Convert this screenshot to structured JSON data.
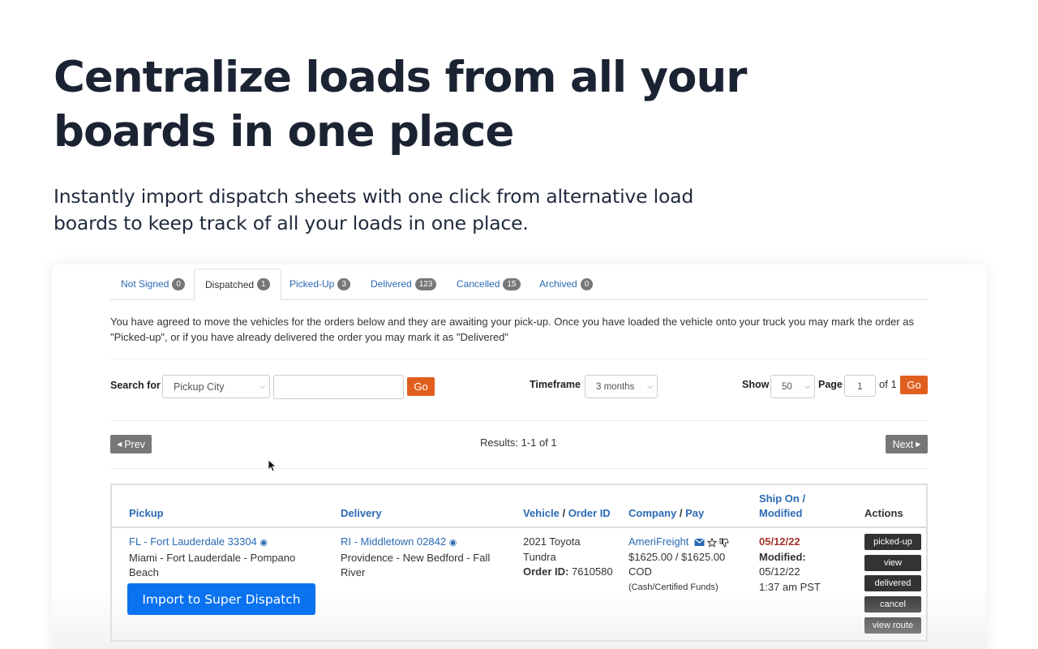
{
  "hero": {
    "title": "Centralize loads from all your boards in one place",
    "subtitle": "Instantly import dispatch sheets with one click from alternative load boards to keep track of all your loads in one place."
  },
  "tabs": [
    {
      "label": "Not Signed",
      "count": "0"
    },
    {
      "label": "Dispatched",
      "count": "1"
    },
    {
      "label": "Picked-Up",
      "count": "3"
    },
    {
      "label": "Delivered",
      "count": "123"
    },
    {
      "label": "Cancelled",
      "count": "15"
    },
    {
      "label": "Archived",
      "count": "0"
    }
  ],
  "notice": "You have agreed to move the vehicles for the orders below and they are awaiting your pick-up. Once you have loaded the vehicle onto your truck you may mark the order as \"Picked-up\", or if you have already delivered the order you may mark it as \"Delivered\"",
  "filters": {
    "search_label": "Search for",
    "search_field": "Pickup City",
    "search_value": "",
    "go_label": "Go",
    "timeframe_label": "Timeframe",
    "timeframe_value": "3 months",
    "show_label": "Show",
    "show_value": "50",
    "page_label": "Page",
    "page_value": "1",
    "page_of": "of 1"
  },
  "pager": {
    "prev": "Prev",
    "next": "Next",
    "results": "Results: 1-1 of 1"
  },
  "table": {
    "headers": {
      "pickup": "Pickup",
      "delivery": "Delivery",
      "vehicle": "Vehicle",
      "slash": "/",
      "order_id": "Order ID",
      "company": "Company",
      "pay": "Pay",
      "ship_on": "Ship On /",
      "modified": "Modified",
      "actions": "Actions"
    },
    "row": {
      "pickup_link": "FL - Fort Lauderdale 33304",
      "pickup_area": "Miami - Fort Lauderdale - Pompano Beach",
      "delivery_link": "RI - Middletown 02842",
      "delivery_area": "Providence - New Bedford - Fall River",
      "vehicle": "2021 Toyota Tundra",
      "order_id_label": "Order ID:",
      "order_id": "7610580",
      "company": "AmeriFreight",
      "pay": "$1625.00 / $1625.00 COD",
      "pay_terms": "(Cash/Certified Funds)",
      "ship_date": "05/12/22",
      "modified_label": "Modified:",
      "modified_date": "05/12/22",
      "modified_time": "1:37 am PST"
    },
    "actions": [
      "picked-up",
      "view",
      "delivered",
      "cancel",
      "view route"
    ]
  },
  "import_button": "Import to Super Dispatch",
  "icons": {
    "tab_badge": "count-badge",
    "location": "map-pin-icon",
    "mail": "envelope-icon",
    "star": "star-icon",
    "thumb": "thumbs-down-icon",
    "cursor": "mouse-pointer-icon"
  }
}
